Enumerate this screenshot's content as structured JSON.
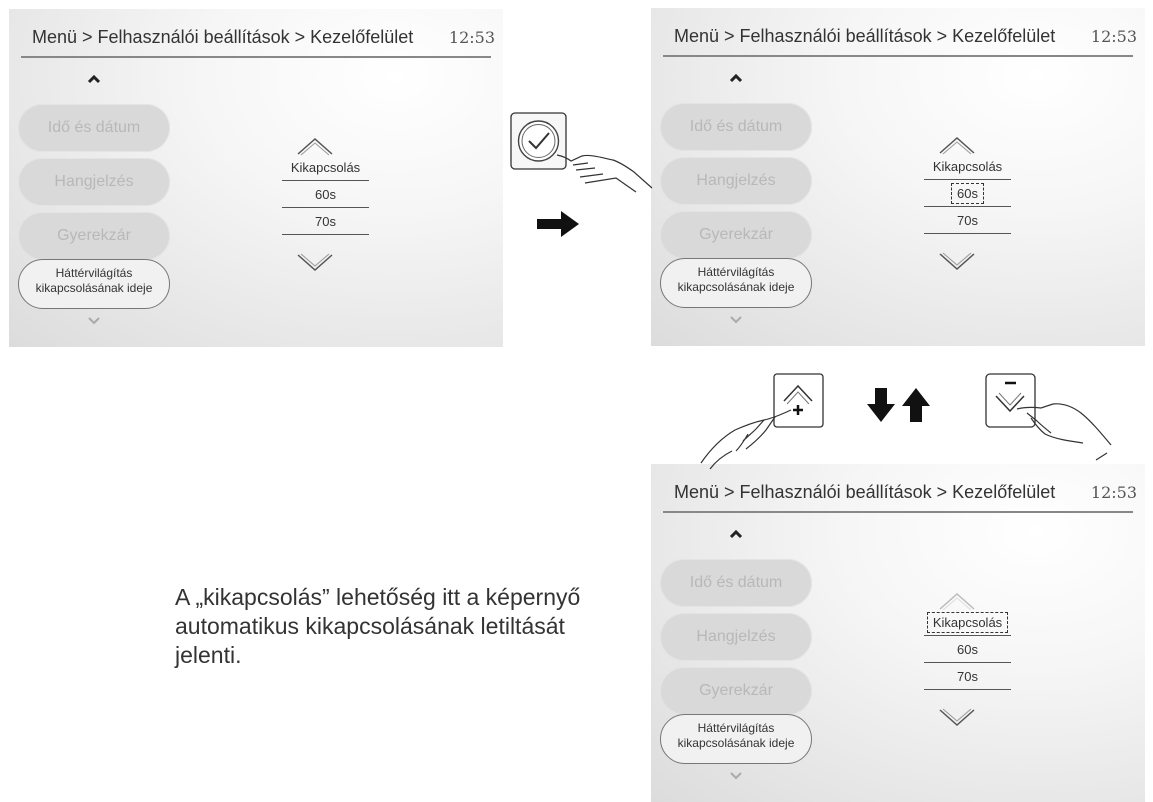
{
  "screens": [
    {
      "breadcrumb": "Menü > Felhasználói beállítások > Kezelőfelület",
      "time": "12:53",
      "menu_items": [
        "Idő és dátum",
        "Hangjelzés",
        "Gyerekzár"
      ],
      "active_item": [
        "Háttérvilágítás",
        "kikapcsolásának ideje"
      ],
      "options": [
        "Kikapcsolás",
        "60s",
        "70s"
      ],
      "highlighted_option": ""
    },
    {
      "breadcrumb": "Menü > Felhasználói beállítások > Kezelőfelület",
      "time": "12:53",
      "menu_items": [
        "Idő és dátum",
        "Hangjelzés",
        "Gyerekzár"
      ],
      "active_item": [
        "Háttérvilágítás",
        "kikapcsolásának ideje"
      ],
      "options": [
        "Kikapcsolás",
        "60s",
        "70s"
      ],
      "highlighted_option": "60s"
    },
    {
      "breadcrumb": "Menü > Felhasználói beállítások > Kezelőfelület",
      "time": "12:53",
      "menu_items": [
        "Idő és dátum",
        "Hangjelzés",
        "Gyerekzár"
      ],
      "active_item": [
        "Háttérvilágítás",
        "kikapcsolásának ideje"
      ],
      "options": [
        "Kikapcsolás",
        "60s",
        "70s"
      ],
      "highlighted_option": "Kikapcsolás"
    }
  ],
  "icons": {
    "confirm": "checkmark-circle-icon",
    "increase": "chevron-up-plus-icon",
    "decrease": "chevron-down-minus-icon",
    "hand": "pointing-hand-icon",
    "next_step": "arrow-right-icon",
    "down": "arrow-down-icon",
    "up": "arrow-up-icon"
  },
  "note": {
    "line1": "A „kikapcsolás” lehetőség itt a képernyő",
    "line2": "automatikus kikapcsolásának letiltását jelenti."
  }
}
